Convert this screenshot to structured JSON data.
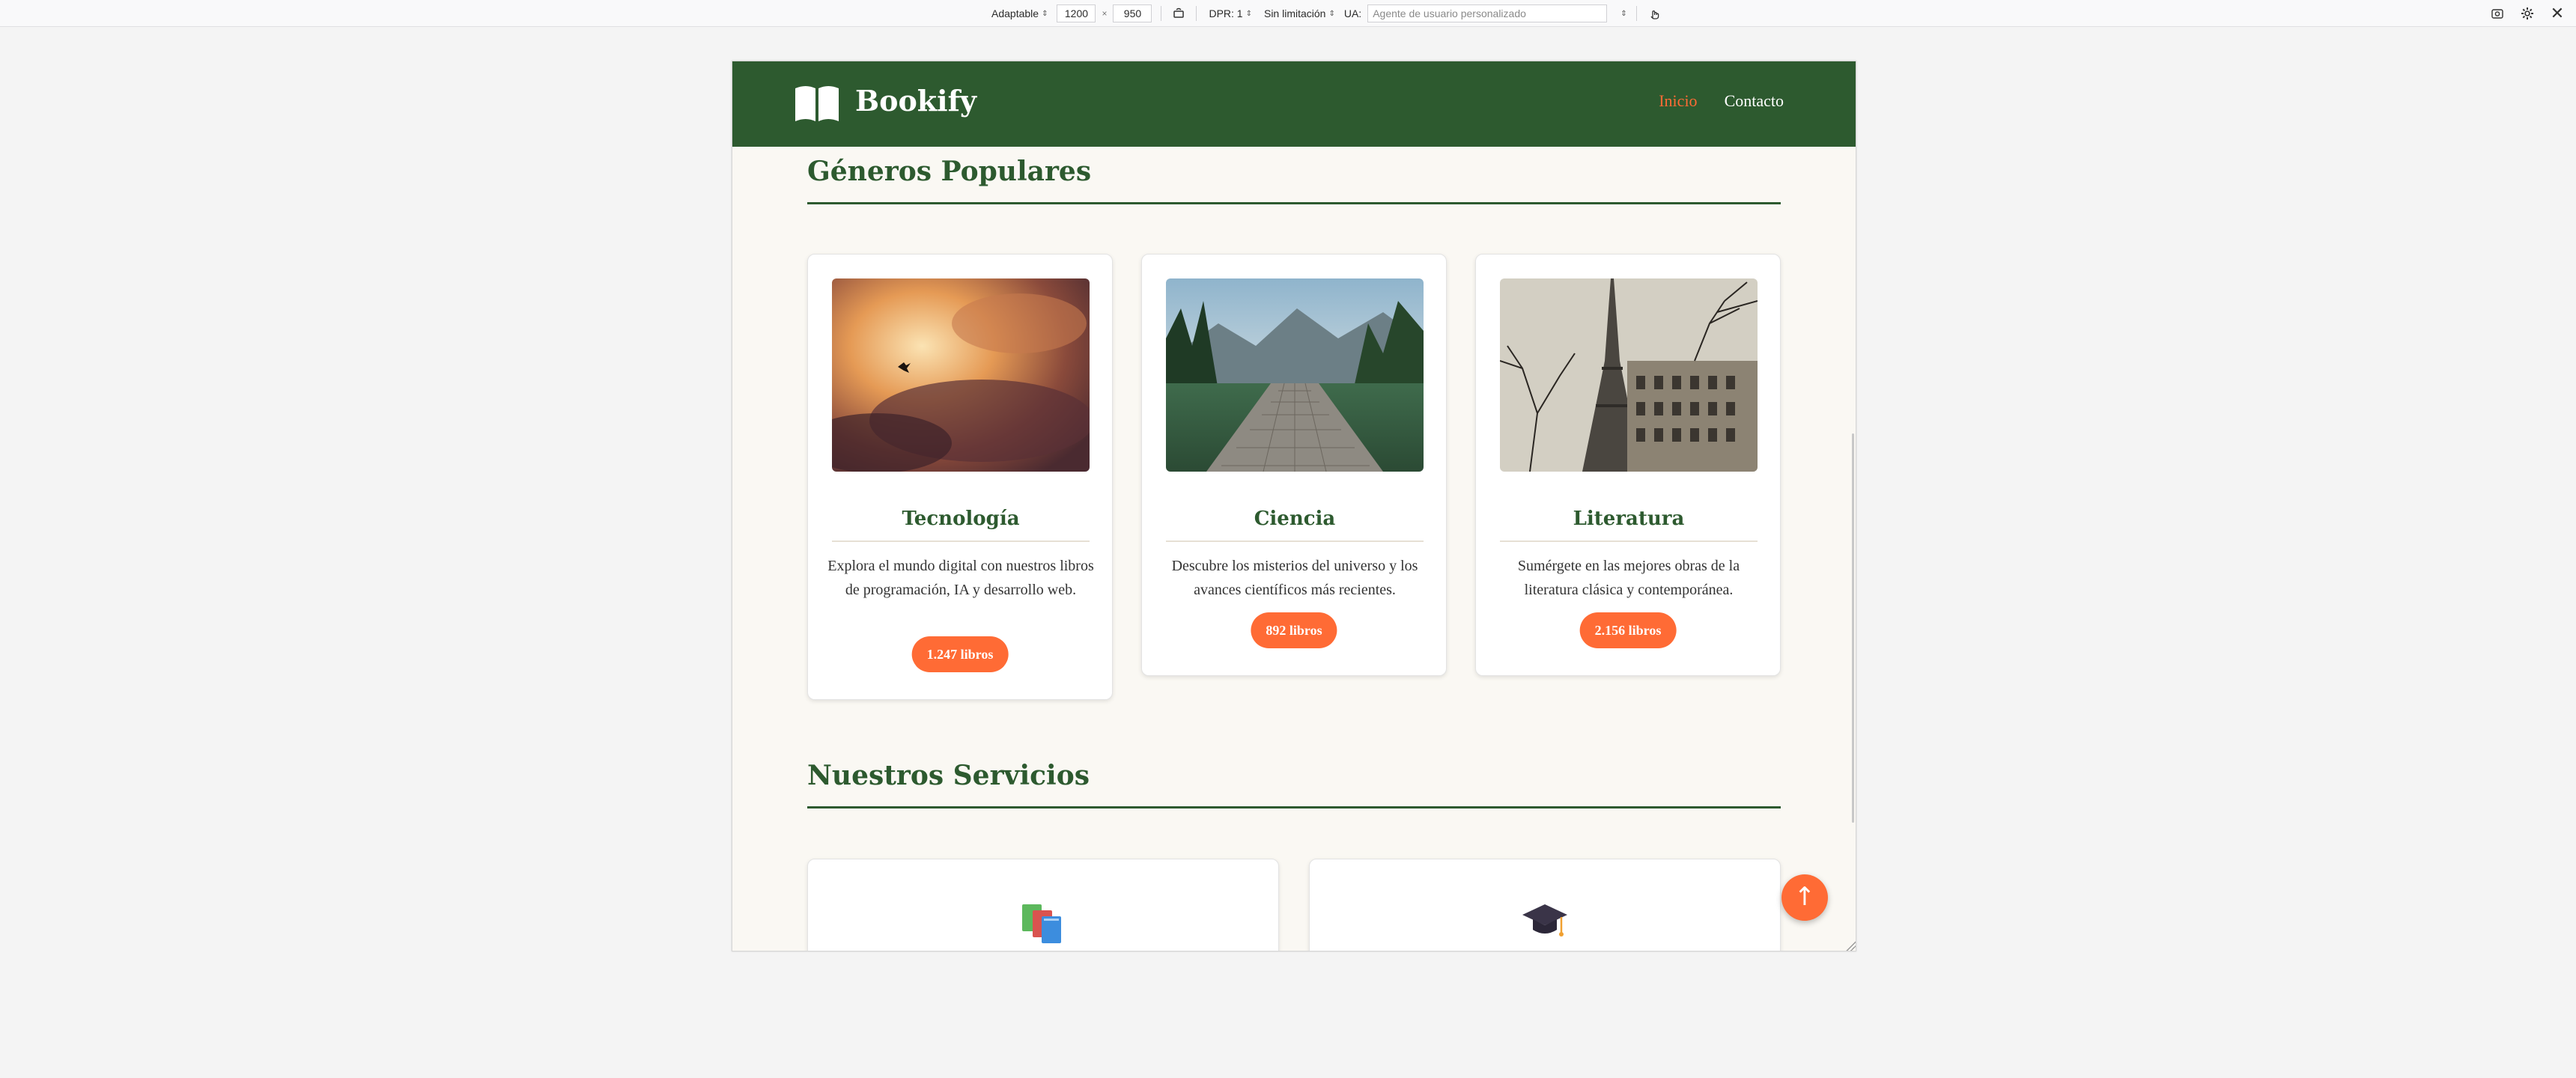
{
  "toolbar": {
    "device_mode": "Adaptable",
    "width": "1200",
    "times": "×",
    "height": "950",
    "dpr": "DPR: 1",
    "throttle": "Sin limitación",
    "ua_label": "UA:",
    "ua_placeholder": "Agente de usuario personalizado",
    "icons": [
      "rotate-icon",
      "touch-icon",
      "screenshot-icon",
      "settings-icon",
      "close-icon"
    ]
  },
  "site": {
    "brand": "Bookify",
    "nav": [
      {
        "label": "Inicio",
        "active": true
      },
      {
        "label": "Contacto",
        "active": false
      }
    ],
    "accent": "#ff6b35",
    "primary": "#2d5a2f"
  },
  "genres": {
    "title": "Géneros Populares",
    "cards": [
      {
        "title": "Tecnología",
        "description": "Explora el mundo digital con nuestros libros de programación, IA y desarrollo web.",
        "count": "1.247 libros"
      },
      {
        "title": "Ciencia",
        "description": "Descubre los misterios del universo y los avances científicos más recientes.",
        "count": "892 libros"
      },
      {
        "title": "Literatura",
        "description": "Sumérgete en las mejores obras de la literatura clásica y contemporánea.",
        "count": "2.156 libros"
      }
    ]
  },
  "services": {
    "title": "Nuestros Servicios",
    "cards": [
      {
        "icon": "books-icon"
      },
      {
        "icon": "graduation-cap-icon"
      }
    ]
  },
  "scroll_top": {
    "icon": "arrow-up-icon",
    "glyph": "↑"
  }
}
